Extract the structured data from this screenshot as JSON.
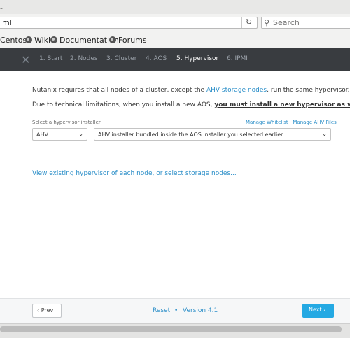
{
  "browser": {
    "url_fragment": "ml",
    "reload_glyph": "↻",
    "search_placeholder": "Search",
    "bookmarks": [
      "Centos",
      "Wiki",
      "Documentation",
      "Forums"
    ]
  },
  "wizard": {
    "logo_glyph": "✕",
    "steps": [
      "1. Start",
      "2. Nodes",
      "3. Cluster",
      "4. AOS",
      "5. Hypervisor",
      "6. IPMI"
    ],
    "active_step": "5. Hypervisor"
  },
  "content": {
    "p1_before": "Nutanix requires that all nodes of a cluster, except the ",
    "p1_link": "AHV storage nodes",
    "p1_after": ", run the same hypervisor.",
    "p2_before": "Due to technical limitations, when you install a new AOS, ",
    "p2_strong": "you must install a new hypervisor as well",
    "p2_after": ":",
    "select_label": "Select a hypervisor installer",
    "manage_whitelist": "Manage Whitelist",
    "link_sep": "·",
    "manage_ahv": "Manage AHV Files",
    "hypervisor_value": "AHV",
    "installer_value": "AHV installer bundled inside the AOS installer you selected earlier",
    "chevron": "⌄",
    "view_link": "View existing hypervisor of each node, or select storage nodes..."
  },
  "footer": {
    "prev_label": "‹ Prev",
    "reset_label": "Reset",
    "dot": "•",
    "version_label": "Version 4.1",
    "next_label": "Next ›"
  },
  "colors": {
    "accent": "#2a8ec8",
    "next_button": "#24a9e3",
    "wizard_bar": "#393c40"
  }
}
